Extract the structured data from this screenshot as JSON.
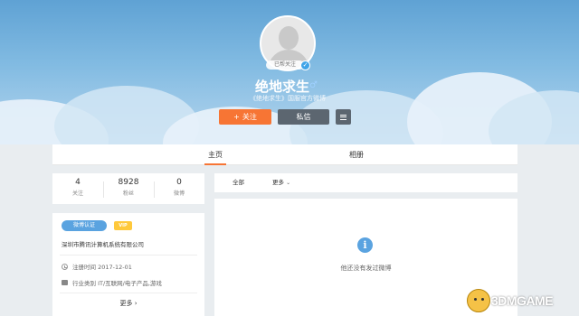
{
  "profile": {
    "avatar_badge": "已帮关注",
    "username": "绝地求生",
    "subtitle": "《绝地求生》国服官方微博"
  },
  "actions": {
    "follow_label": "关注",
    "message_label": "私信"
  },
  "tabs": [
    {
      "label": "主页"
    },
    {
      "label": "相册"
    }
  ],
  "stats": [
    {
      "value": "4",
      "label": "关注"
    },
    {
      "value": "8928",
      "label": "粉丝"
    },
    {
      "value": "0",
      "label": "微博"
    }
  ],
  "info": {
    "verify_tag": "微博认证",
    "vip_tag": "VIP",
    "company": "深圳市腾讯计算机系统有限公司",
    "register_time": "注册时间 2017-12-01",
    "industry": "行业类别 IT/互联网/电子产品,游戏",
    "more": "更多 ›"
  },
  "feed": {
    "filter_all": "全部",
    "filter_more": "更多",
    "empty_text": "他还没有发过微博"
  },
  "watermark": {
    "text": "3DMGAME"
  },
  "colors": {
    "follow_button": "#f77534",
    "message_button": "#5c6670",
    "accent_blue": "#5aa3e0",
    "vip_yellow": "#ffc93c"
  }
}
